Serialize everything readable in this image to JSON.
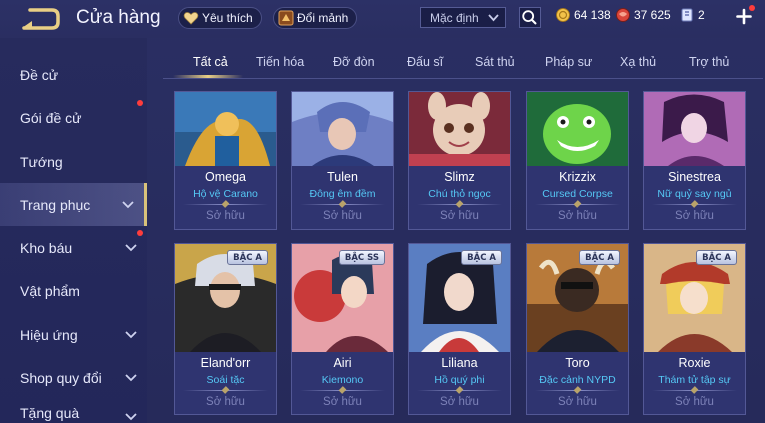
{
  "header": {
    "title": "Cửa hàng",
    "favorites_label": "Yêu thích",
    "exchange_label": "Đổi mảnh",
    "sort_value": "Mặc định",
    "gold": "64 138",
    "gems": "37 625",
    "vouchers": "2"
  },
  "sidebar": {
    "items": [
      {
        "label": "Đề cử"
      },
      {
        "label": "Gói đề cử"
      },
      {
        "label": "Tướng"
      },
      {
        "label": "Trang phục"
      },
      {
        "label": "Kho báu"
      },
      {
        "label": "Vật phẩm"
      },
      {
        "label": "Hiệu ứng"
      },
      {
        "label": "Shop quy đổi"
      },
      {
        "label": "Tặng quà"
      }
    ]
  },
  "tabs": [
    "Tất cả",
    "Tiến hóa",
    "Đỡ đòn",
    "Đấu sĩ",
    "Sát thủ",
    "Pháp sư",
    "Xạ thủ",
    "Trợ thủ"
  ],
  "cards": [
    {
      "hero": "Omega",
      "skin": "Hộ vệ Carano",
      "status": "Sở hữu",
      "badge": ""
    },
    {
      "hero": "Tulen",
      "skin": "Đông êm đềm",
      "status": "Sở hữu",
      "badge": ""
    },
    {
      "hero": "Slimz",
      "skin": "Chú thỏ ngọc",
      "status": "Sở hữu",
      "badge": ""
    },
    {
      "hero": "Krizzix",
      "skin": "Cursed Corpse",
      "status": "Sở hữu",
      "badge": ""
    },
    {
      "hero": "Sinestrea",
      "skin": "Nữ quỷ say ngủ",
      "status": "Sở hữu",
      "badge": ""
    },
    {
      "hero": "Eland'orr",
      "skin": "Soái tặc",
      "status": "Sở hữu",
      "badge": "BẬC A"
    },
    {
      "hero": "Airi",
      "skin": "Kiemono",
      "status": "Sở hữu",
      "badge": "BẬC SS"
    },
    {
      "hero": "Liliana",
      "skin": "Hồ quý phi",
      "status": "Sở hữu",
      "badge": "BẬC A"
    },
    {
      "hero": "Toro",
      "skin": "Đặc cảnh NYPD",
      "status": "Sở hữu",
      "badge": "BẬC A"
    },
    {
      "hero": "Roxie",
      "skin": "Thám tử tập sự",
      "status": "Sở hữu",
      "badge": "BẬC A"
    }
  ],
  "colors": {
    "accent_gold": "#e9cf85",
    "skin_text": "#55c8f5",
    "owned_text": "#7d82b8",
    "notification": "#ff3c3c"
  }
}
